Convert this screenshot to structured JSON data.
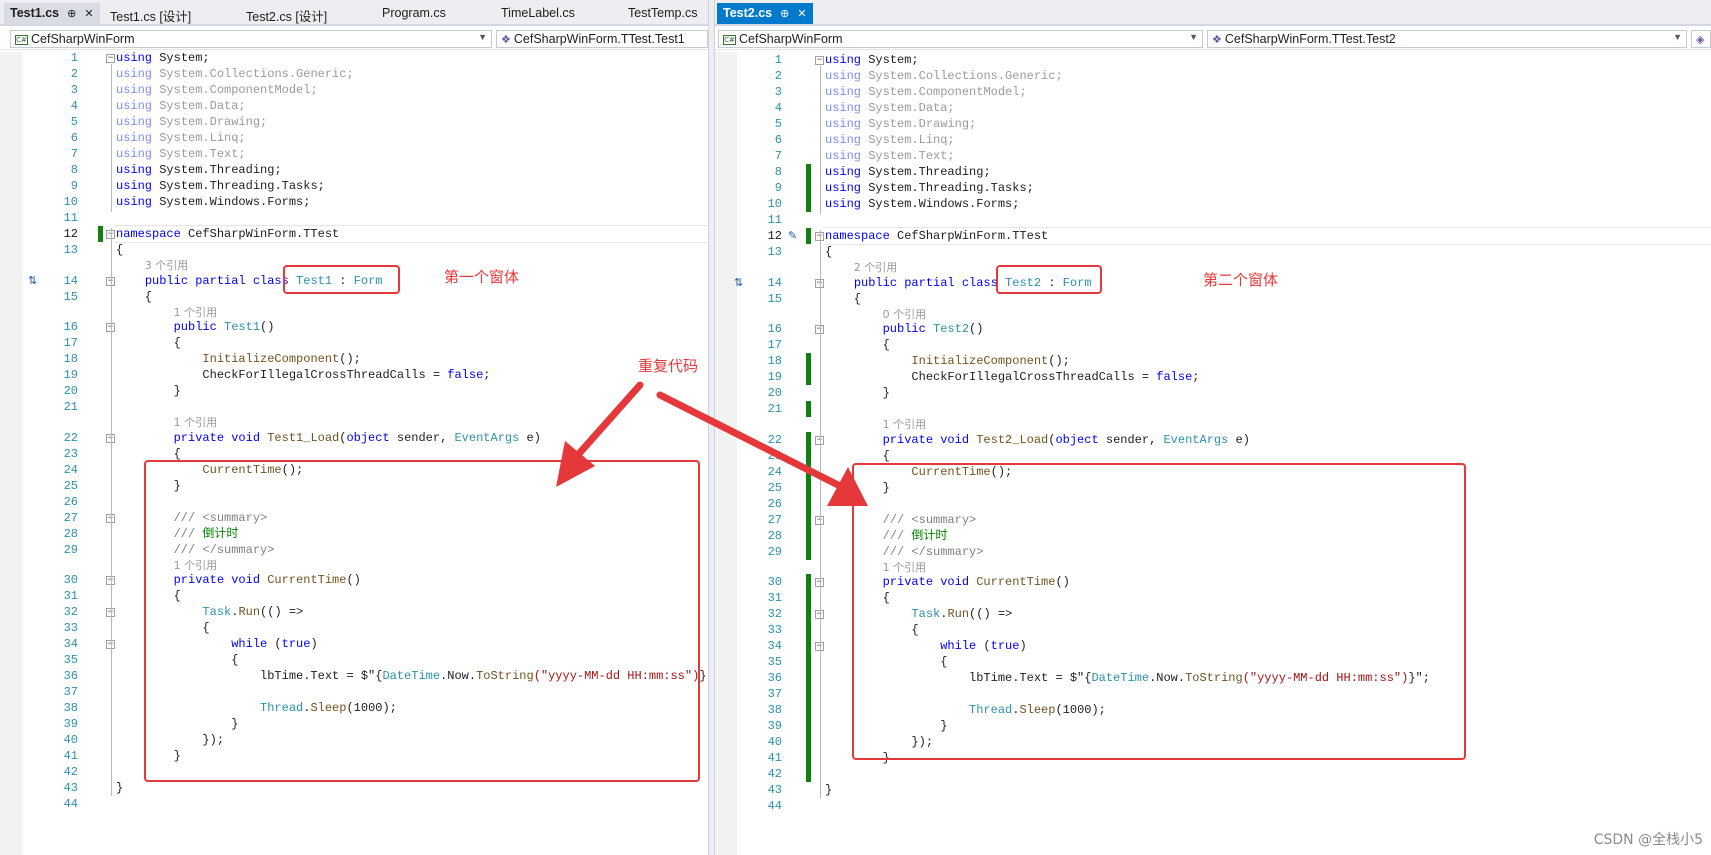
{
  "left": {
    "tabs": [
      {
        "label": "Test1.cs",
        "pin": "⊕",
        "close": "✕"
      },
      {
        "label": "Test1.cs [设计]"
      },
      {
        "label": "Test2.cs [设计]"
      },
      {
        "label": "Program.cs"
      },
      {
        "label": "TimeLabel.cs"
      },
      {
        "label": "TestTemp.cs"
      }
    ],
    "nav_project": "CefSharpWinForm",
    "nav_member": "CefSharpWinForm.TTest.Test1",
    "refs": {
      "class": "3 个引用",
      "ctor": "1 个引用",
      "load": "1 个引用",
      "current": "1 个引用"
    },
    "class_name": "Test1",
    "ctor_name": "Test1",
    "load_name": "Test1_Load",
    "annotation": "第一个窗体"
  },
  "right": {
    "tabs": [
      {
        "label": "Test2.cs",
        "pin": "⊕",
        "close": "✕"
      }
    ],
    "nav_project": "CefSharpWinForm",
    "nav_member": "CefSharpWinForm.TTest.Test2",
    "refs": {
      "class": "2 个引用",
      "ctor": "0 个引用",
      "load": "1 个引用",
      "current": "1 个引用"
    },
    "class_name": "Test2",
    "ctor_name": "Test2",
    "load_name": "Test2_Load",
    "annotation": "第二个窗体"
  },
  "arrow_label": "重复代码",
  "code": {
    "usings": [
      "System",
      "System.Collections.Generic",
      "System.ComponentModel",
      "System.Data",
      "System.Drawing",
      "System.Linq",
      "System.Text",
      "System.Threading",
      "System.Threading.Tasks",
      "System.Windows.Forms"
    ],
    "namespace": "CefSharpWinForm.TTest",
    "base_class": "Form",
    "init_call": "InitializeComponent",
    "cross_thread": "CheckForIllegalCrossThreadCalls",
    "false_kw": "false",
    "load_params": [
      "object",
      "sender",
      "EventArgs",
      "e"
    ],
    "current_time": "CurrentTime",
    "summary_open": "/// <summary>",
    "summary_text": "倒计时",
    "summary_close": "/// </summary>",
    "task_run": "Task.Run(() =>",
    "while_kw": "while",
    "true_kw": "true",
    "lbtime": "lbTime.Text = $\"",
    "datetime": "DateTime.Now.ToString",
    "format": "(\"yyyy-MM-dd HH:mm:ss\")",
    "sleep": "Thread.Sleep(1000);"
  },
  "colors": {
    "annotation": "#e5383b",
    "keyword": "#0000ff",
    "type": "#2b91af",
    "modified_bar": "#108010"
  },
  "watermark": "CSDN @全栈小5"
}
